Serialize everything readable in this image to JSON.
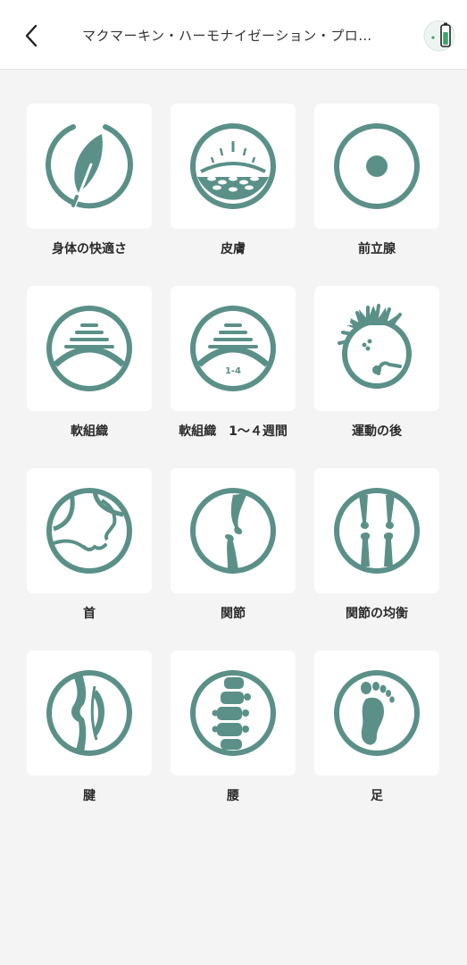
{
  "header": {
    "title": "マクマーキン・ハーモナイゼーション・プロ…"
  },
  "colors": {
    "icon": "#5a9088",
    "battery": "#3fa56b"
  },
  "modes": [
    {
      "label": "身体の快適さ",
      "icon": "feather-icon"
    },
    {
      "label": "皮膚",
      "icon": "skin-icon"
    },
    {
      "label": "前立腺",
      "icon": "prostate-icon"
    },
    {
      "label": "軟組織",
      "icon": "soft-tissue-icon"
    },
    {
      "label": "軟組織　1～４週間",
      "icon": "soft-tissue-weeks-icon",
      "badge": "1-4"
    },
    {
      "label": "運動の後",
      "icon": "post-exercise-icon"
    },
    {
      "label": "首",
      "icon": "neck-icon"
    },
    {
      "label": "関節",
      "icon": "joint-icon"
    },
    {
      "label": "関節の均衡",
      "icon": "joint-balance-icon"
    },
    {
      "label": "腱",
      "icon": "tendon-icon"
    },
    {
      "label": "腰",
      "icon": "spine-icon"
    },
    {
      "label": "足",
      "icon": "foot-icon"
    }
  ]
}
